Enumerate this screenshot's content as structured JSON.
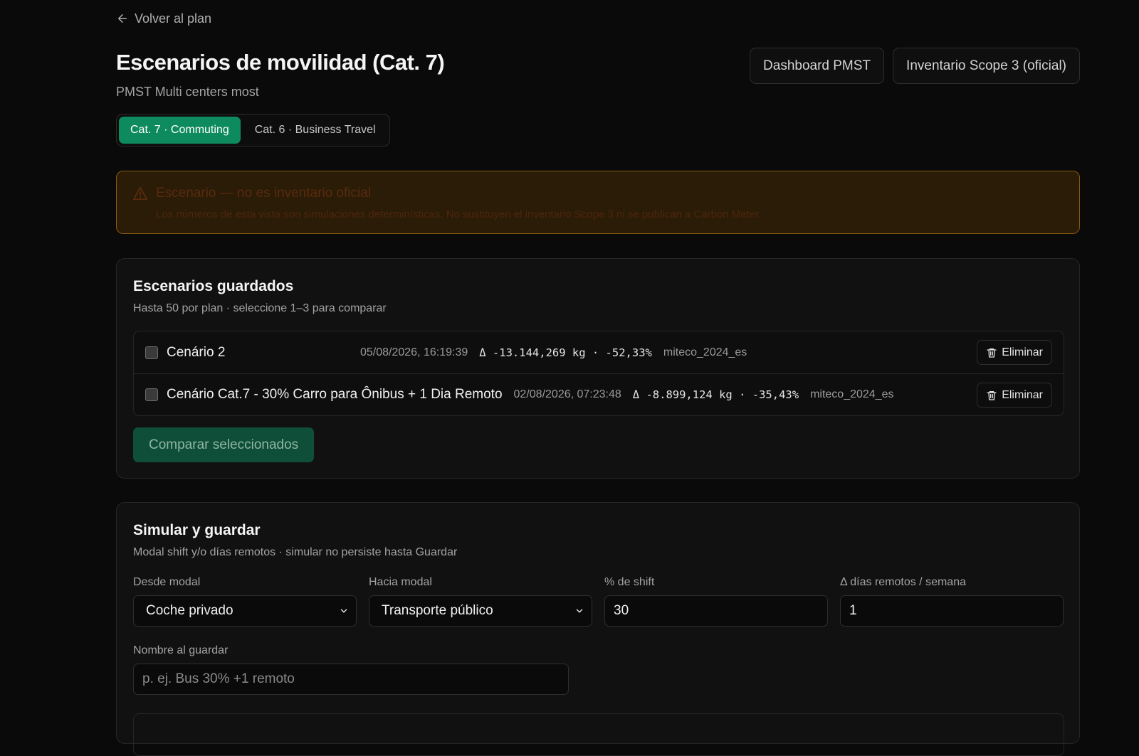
{
  "back_link": {
    "label": "Volver al plan"
  },
  "header": {
    "title": "Escenarios de movilidad (Cat. 7)",
    "subtitle": "PMST Multi centers most",
    "buttons": {
      "dashboard": "Dashboard PMST",
      "inventory": "Inventario Scope 3 (oficial)"
    }
  },
  "tabs": [
    {
      "label": "Cat. 7 · Commuting",
      "active": true
    },
    {
      "label": "Cat. 6 · Business Travel",
      "active": false
    }
  ],
  "warning": {
    "title": "Escenario — no es inventario oficial",
    "text": "Los números de esta vista son simulaciones determinísticas. No sustituyen el inventario Scope 3 ni se publican a Carbon Meter."
  },
  "saved": {
    "title": "Escenarios guardados",
    "description": "Hasta 50 por plan · seleccione 1–3 para comparar",
    "rows": [
      {
        "name": "Cenário 2",
        "date": "05/08/2026, 16:19:39",
        "delta": "Δ -13.144,269 kg · -52,33%",
        "source": "miteco_2024_es",
        "delete_label": "Eliminar"
      },
      {
        "name": "Cenário Cat.7 - 30% Carro para Ônibus + 1 Dia Remoto",
        "date": "02/08/2026, 07:23:48",
        "delta": "Δ -8.899,124 kg · -35,43%",
        "source": "miteco_2024_es",
        "delete_label": "Eliminar"
      }
    ],
    "compare_label": "Comparar seleccionados"
  },
  "simulate": {
    "title": "Simular y guardar",
    "description": "Modal shift y/o días remotos · simular no persiste hasta Guardar",
    "from_label": "Desde modal",
    "from_value": "Coche privado",
    "to_label": "Hacia modal",
    "to_value": "Transporte público",
    "shift_label": "% de shift",
    "shift_value": "30",
    "remote_label": "Δ días remotos / semana",
    "remote_value": "1",
    "name_label": "Nombre al guardar",
    "name_placeholder": "p. ej. Bus 30% +1 remoto"
  },
  "colors": {
    "accent": "#0e8a5f",
    "warning_border": "#8a5a10",
    "warning_bg": "#2a1c07"
  }
}
